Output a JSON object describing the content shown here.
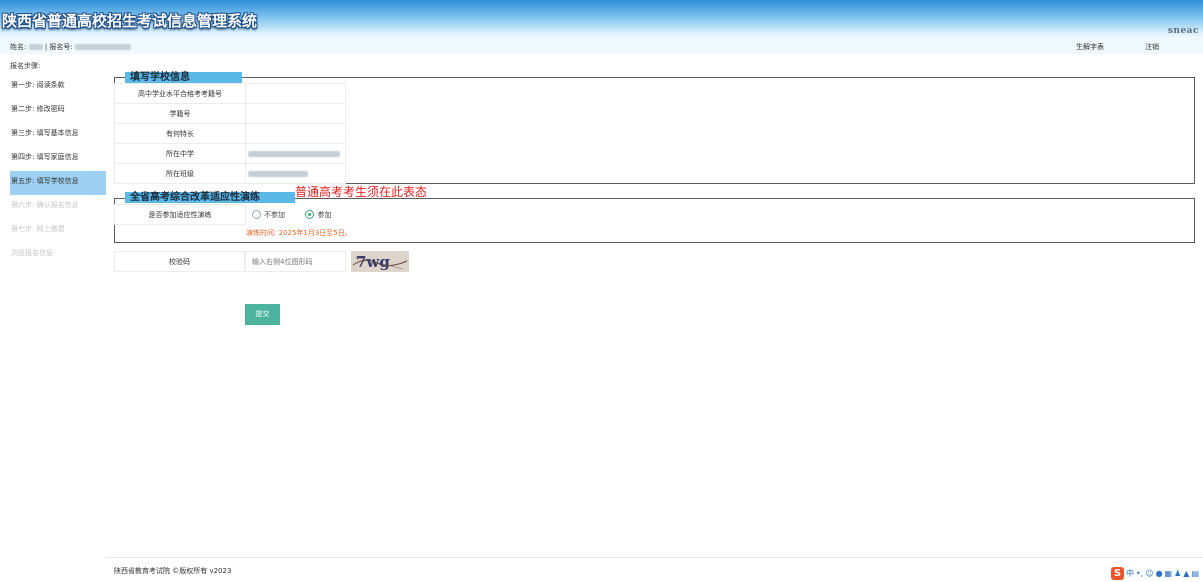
{
  "app": {
    "title": "陕西省普通高校招生考试信息管理系统",
    "brand": "sneac"
  },
  "header": {
    "name_label": "姓名:",
    "reg_label": "报名号:",
    "separator": "|",
    "links": {
      "new_student_table": "生解字表",
      "logout": "注销"
    }
  },
  "sidebar": {
    "heading": "报名步骤:",
    "steps": [
      {
        "label": "第一步: 阅读条款",
        "state": "done"
      },
      {
        "label": "第二步: 修改密码",
        "state": "done"
      },
      {
        "label": "第三步: 填写基本信息",
        "state": "done"
      },
      {
        "label": "第四步: 填写家庭信息",
        "state": "done"
      },
      {
        "label": "第五步: 填写学校信息",
        "state": "active"
      },
      {
        "label": "第六步: 确认报名信息",
        "state": "disabled"
      },
      {
        "label": "第七步: 网上缴费",
        "state": "disabled"
      },
      {
        "label": "浏览报名信息",
        "state": "disabled"
      }
    ]
  },
  "school_section": {
    "legend": "填写学校信息",
    "rows": [
      {
        "label": "高中学业水平合格考考籍号",
        "value": ""
      },
      {
        "label": "学籍号",
        "value": ""
      },
      {
        "label": "有何特长",
        "value": ""
      },
      {
        "label": "所在中学",
        "value": ""
      },
      {
        "label": "所在班级",
        "value": ""
      }
    ]
  },
  "drill_section": {
    "legend": "全省高考综合改革适应性演练",
    "note": "普通高考考生须在此表态",
    "question": "是否参加适应性演练",
    "options": [
      "不参加",
      "参加"
    ],
    "selected": "参加",
    "hint": "演练时间: 2025年1月3日至5日。"
  },
  "captcha": {
    "label": "校验码",
    "placeholder": "输入右侧4位图形码",
    "image_text": "7wg"
  },
  "submit_label": "提交",
  "footer": "陕西省教育考试院 ©版权所有 v2023",
  "ime": {
    "logo": "S",
    "lang": "中"
  },
  "colors": {
    "banner_top": "#2f8fd6",
    "legend_bg": "#5cb8e6",
    "active_step": "#9ed0f3",
    "submit": "#4bb39e",
    "note_red": "#e02020",
    "hint_orange": "#e7652a"
  }
}
